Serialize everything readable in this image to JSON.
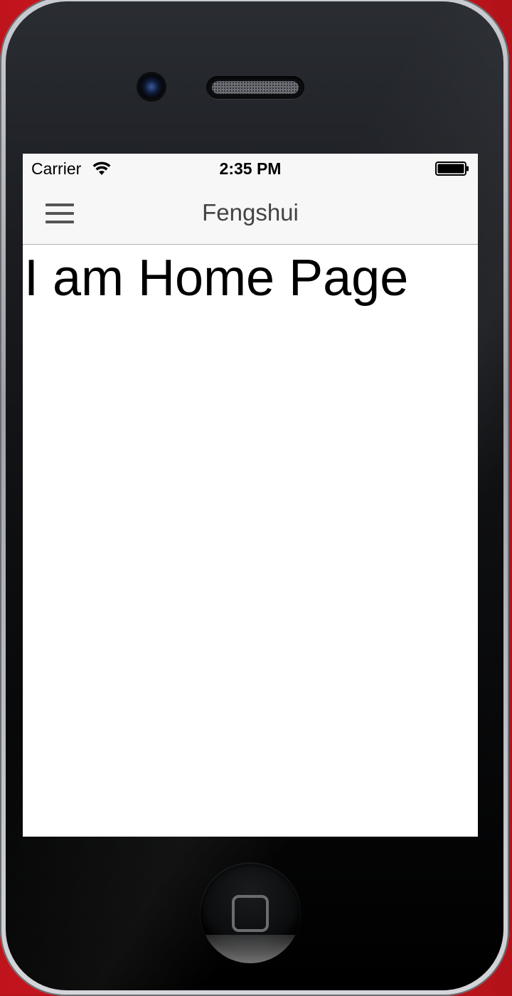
{
  "status_bar": {
    "carrier": "Carrier",
    "time": "2:35 PM",
    "wifi_icon": "wifi-icon",
    "battery_icon": "battery-full-icon"
  },
  "nav_bar": {
    "title": "Fengshui",
    "menu_icon": "hamburger-menu-icon"
  },
  "content": {
    "heading": "I am Home Page"
  },
  "device": {
    "home_button_icon": "home-square-icon"
  },
  "colors": {
    "background": "#c0141c",
    "nav_bar_bg": "#f7f7f7",
    "title_color": "#444444",
    "heading_color": "#000000"
  }
}
